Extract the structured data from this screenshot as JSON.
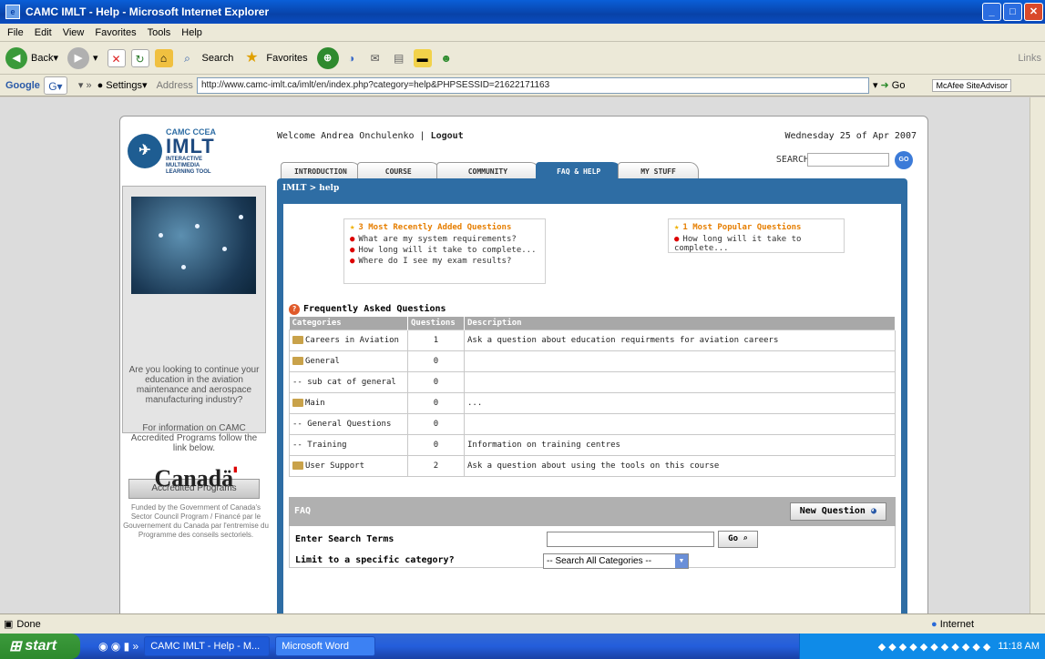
{
  "window": {
    "title": "CAMC IMLT - Help - Microsoft Internet Explorer"
  },
  "menu": [
    "File",
    "Edit",
    "View",
    "Favorites",
    "Tools",
    "Help"
  ],
  "toolbar": {
    "back": "Back",
    "search": "Search",
    "favorites": "Favorites",
    "links": "Links"
  },
  "addressbar": {
    "google": "Google",
    "settings": "Settings",
    "address_label": "Address",
    "url": "http://www.camc-imlt.ca/imlt/en/index.php?category=help&PHPSESSID=21622171163",
    "go": "Go",
    "mcafee": "McAfee SiteAdvisor"
  },
  "status": {
    "text": "Done",
    "zone": "Internet"
  },
  "taskbar": {
    "start": "start",
    "items": [
      "CAMC IMLT - Help - M...",
      "Microsoft Word"
    ],
    "clock": "11:18 AM"
  },
  "logo": {
    "line1": "CAMC CCEA",
    "line2": "IMLT",
    "line3": "INTERACTIVE MULTIMEDIA LEARNING TOOL"
  },
  "sidebar": {
    "text1": "Are you looking to continue your education in the aviation maintenance and aerospace manufacturing industry?",
    "text2": "For information on CAMC Accredited Programs follow the link below.",
    "button": "Accredited Programs",
    "canada": "Canadä",
    "funded": "Funded by the Government of Canada's Sector Council Program / Financé par le Gouvernement du Canada par l'entremise du Programme des conseils sectoriels."
  },
  "header": {
    "welcome": "Welcome Andrea Onchulenko | ",
    "logout": "Logout",
    "date": "Wednesday 25 of Apr 2007",
    "search_label": "SEARCH",
    "search_go": "GO"
  },
  "tabs": [
    {
      "label": "INTRODUCTION"
    },
    {
      "label": "COURSE"
    },
    {
      "label": "COMMUNITY"
    },
    {
      "label": "FAQ & HELP"
    },
    {
      "label": "MY STUFF"
    }
  ],
  "breadcrumb": "IMLT > help",
  "recent": {
    "title": "3 Most Recently Added Questions",
    "items": [
      "What are my system requirements?",
      "How long will it take to complete...",
      "Where do I see my exam results?"
    ]
  },
  "popular": {
    "title": "1 Most Popular Questions",
    "items": [
      "How long will it take to complete..."
    ]
  },
  "faq": {
    "title": "Frequently Asked Questions",
    "headers": [
      "Categories",
      "Questions",
      "Description"
    ],
    "rows": [
      {
        "name": "Careers in Aviation",
        "count": "1",
        "desc": "Ask a question about education requirments for aviation careers"
      },
      {
        "name": "General",
        "count": "0",
        "desc": ""
      },
      {
        "name": "-- sub cat of general",
        "count": "0",
        "desc": ""
      },
      {
        "name": "Main",
        "count": "0",
        "desc": "..."
      },
      {
        "name": "-- General Questions",
        "count": "0",
        "desc": ""
      },
      {
        "name": "-- Training",
        "count": "0",
        "desc": "Information on training centres"
      },
      {
        "name": "User Support",
        "count": "2",
        "desc": "Ask a question about using the tools on this course"
      }
    ]
  },
  "faqform": {
    "bar_label": "FAQ",
    "new_question": "New Question",
    "search_label": "Enter Search Terms",
    "go": "Go",
    "limit_label": "Limit to a specific category?",
    "select_value": "-- Search All Categories --"
  }
}
